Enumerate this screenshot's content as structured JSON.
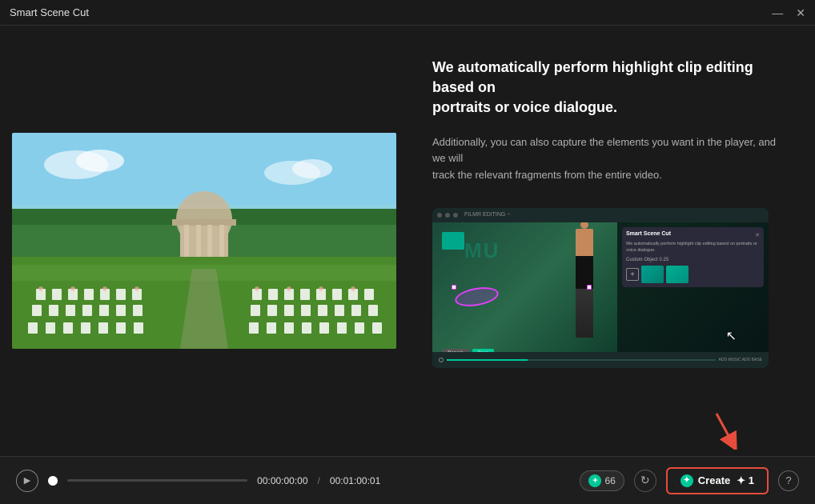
{
  "titleBar": {
    "title": "Smart Scene Cut",
    "minimizeIcon": "—",
    "closeIcon": "✕"
  },
  "infoPanelHeadline": "We automatically perform highlight clip editing based on\nportraits or voice dialogue.",
  "infoPanelSubtext": "Additionally, you can also capture the elements you want in the player, and we will\ntrack the relevant fragments from the entire video.",
  "demoDialog": {
    "title": "Smart Scene Cut",
    "body": "We automatically perform highlight clip editing based on portraits or voice dialogue.",
    "customObjectLabel": "Custom Object  0.25",
    "cancelLabel": "Cancel",
    "saveLabel": "Save"
  },
  "bottomBar": {
    "playIcon": "▶",
    "currentTime": "00:00:00:00",
    "separator": "/",
    "totalTime": "00:01:00:01",
    "badgeCount": "66",
    "createLabel": "Create",
    "createCount": "1"
  }
}
